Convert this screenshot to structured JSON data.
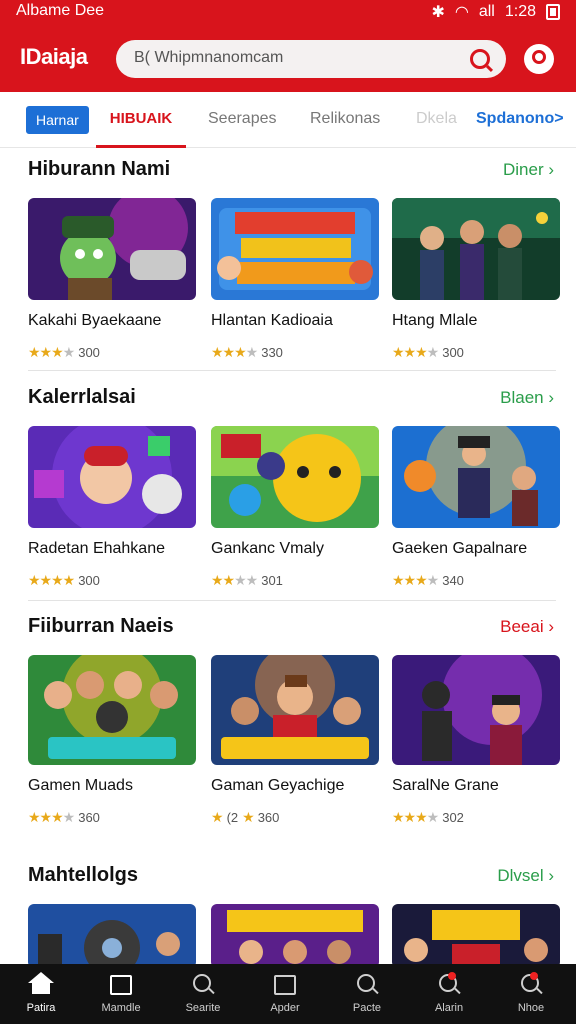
{
  "status_bar": {
    "carrier": "Albame Dee",
    "time": "1:28",
    "signal": "all"
  },
  "header": {
    "logo": "IDaiaja",
    "search_value": "B( Whipmnanomcam"
  },
  "tabs": {
    "pill": "Harnar",
    "active": "HIBUAIK",
    "t1": "Seerapes",
    "t2": "Relikonas",
    "t3": "Dkela",
    "t4": "Spdanono>"
  },
  "sections": [
    {
      "title": "Hiburann Nami",
      "more": "Diner",
      "cards": [
        {
          "title": "Kakahi Byaekaane",
          "rating": "300",
          "stars": 3
        },
        {
          "title": "Hlantan Kadioaia",
          "rating": "330",
          "stars": 3
        },
        {
          "title": "Htang Mlale",
          "rating": "300",
          "stars": 3
        }
      ]
    },
    {
      "title": "Kalerrlalsai",
      "more": "Blaen",
      "cards": [
        {
          "title": "Radetan Ehahkane",
          "rating": "300",
          "stars": 4
        },
        {
          "title": "Gankanc Vmaly",
          "rating": "301",
          "stars": 2
        },
        {
          "title": "Gaeken Gapalnare",
          "rating": "340",
          "stars": 3
        }
      ]
    },
    {
      "title": "Fiiburran Naeis",
      "more": "Beeai",
      "cards": [
        {
          "title": "Gamen Muads",
          "rating": "360",
          "stars": 3
        },
        {
          "title": "Gaman Geyachige",
          "rating": "360",
          "stars": 2,
          "extra": "(2"
        },
        {
          "title": "SaralNe Grane",
          "rating": "302",
          "stars": 3
        }
      ]
    },
    {
      "title": "Mahtellolgs",
      "more": "Dlvsel"
    }
  ],
  "bottom_nav": [
    {
      "label": "Patira",
      "icon": "home-icon"
    },
    {
      "label": "Mamdle",
      "icon": "media-icon"
    },
    {
      "label": "Searite",
      "icon": "search-icon"
    },
    {
      "label": "Apder",
      "icon": "box-icon"
    },
    {
      "label": "Pacte",
      "icon": "search-icon"
    },
    {
      "label": "Alarin",
      "icon": "alert-search-icon"
    },
    {
      "label": "Nhoe",
      "icon": "alert-search-icon"
    }
  ],
  "colors": {
    "brand": "#d8141c",
    "accent": "#1d6fd6",
    "more": "#2a9d4a",
    "star": "#e8a91a"
  }
}
